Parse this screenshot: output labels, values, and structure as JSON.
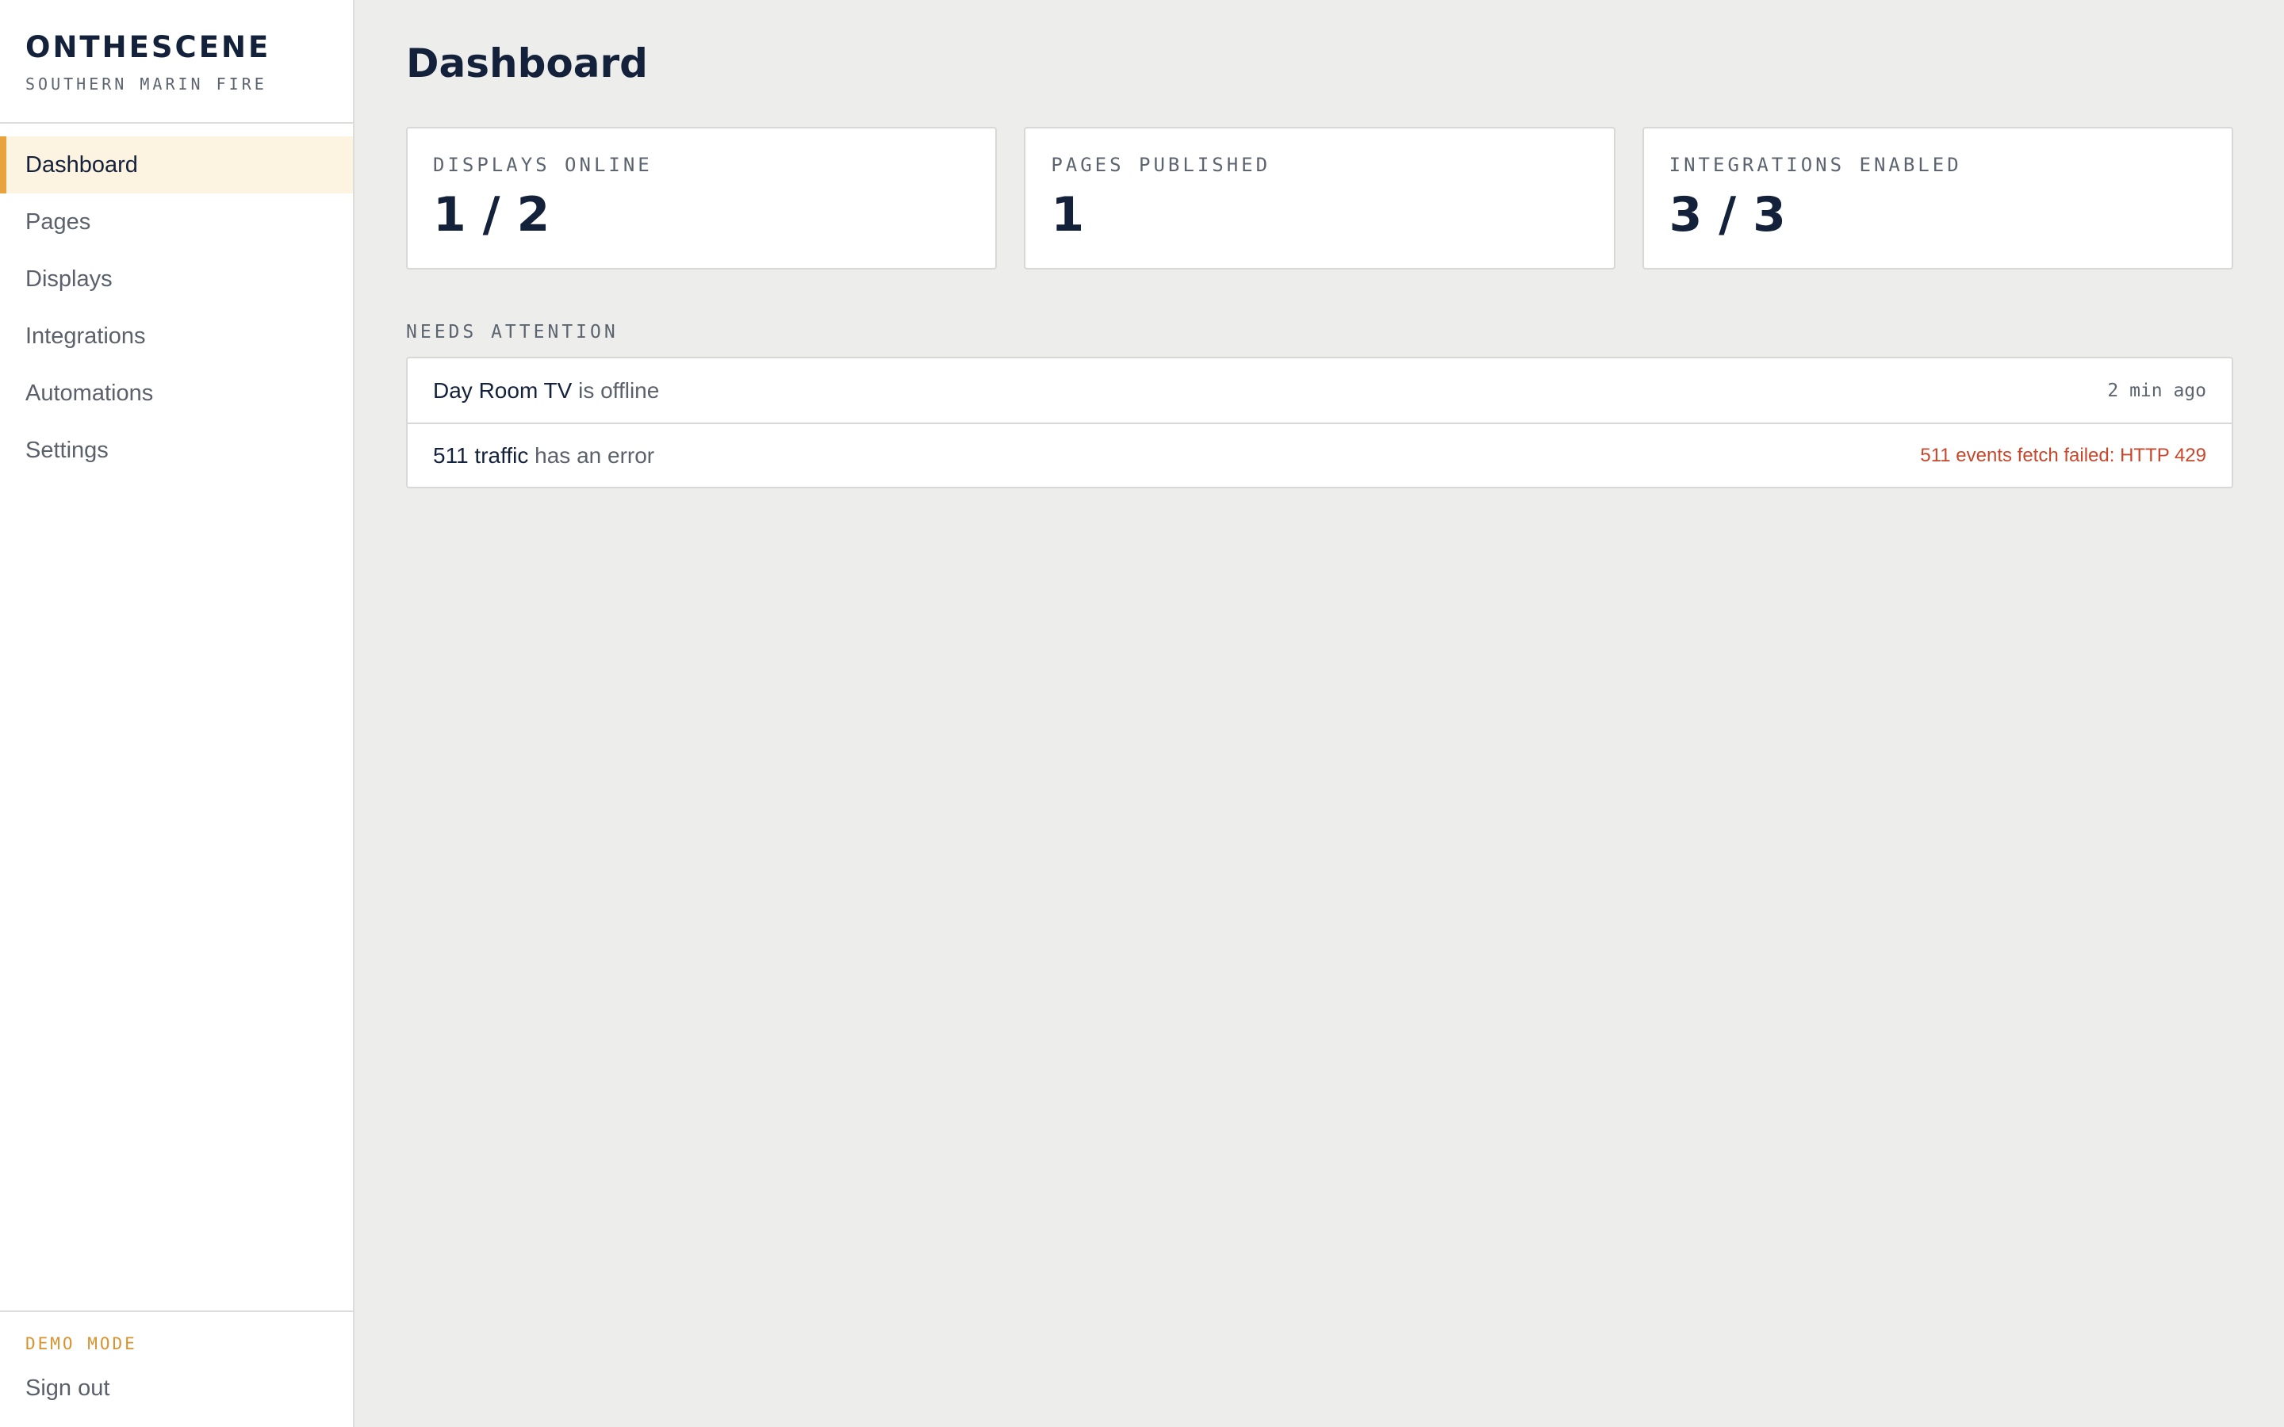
{
  "brand": {
    "name": "ONTHESCENE",
    "subtitle": "SOUTHERN MARIN FIRE"
  },
  "sidebar": {
    "items": [
      {
        "label": "Dashboard",
        "active": true
      },
      {
        "label": "Pages",
        "active": false
      },
      {
        "label": "Displays",
        "active": false
      },
      {
        "label": "Integrations",
        "active": false
      },
      {
        "label": "Automations",
        "active": false
      },
      {
        "label": "Settings",
        "active": false
      }
    ],
    "mode_label": "DEMO MODE",
    "sign_out_label": "Sign out"
  },
  "main": {
    "title": "Dashboard",
    "stats": [
      {
        "label": "DISPLAYS ONLINE",
        "value": "1 / 2"
      },
      {
        "label": "PAGES PUBLISHED",
        "value": "1"
      },
      {
        "label": "INTEGRATIONS ENABLED",
        "value": "3 / 3"
      }
    ],
    "attention": {
      "label": "NEEDS ATTENTION",
      "items": [
        {
          "name": "Day Room TV",
          "status": " is offline",
          "detail": "2 min ago",
          "detail_type": "time"
        },
        {
          "name": "511 traffic",
          "status": " has an error",
          "detail": "511 events fetch failed: HTTP 429",
          "detail_type": "error"
        }
      ]
    }
  },
  "colors": {
    "accent": "#e8a33d",
    "active_bg": "#fcf3e0",
    "error": "#c8472b",
    "text_primary": "#14213a",
    "background": "#ededeb"
  }
}
